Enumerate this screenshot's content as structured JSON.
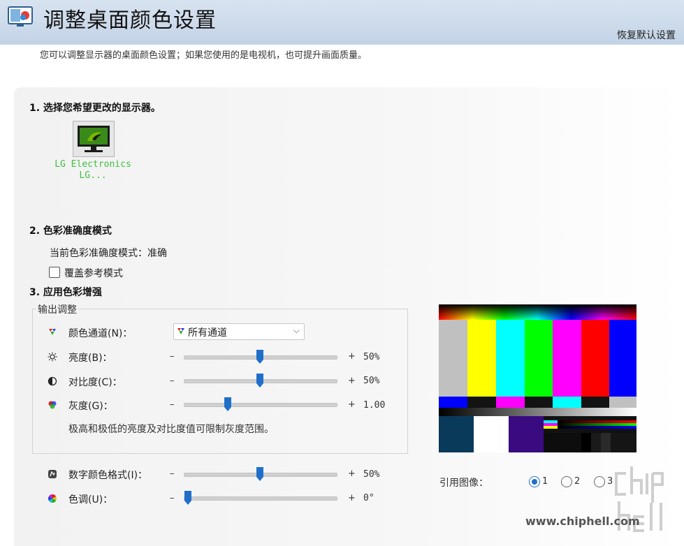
{
  "header": {
    "title": "调整桌面颜色设置",
    "restore_label": "恢复默认设置"
  },
  "description": "您可以调整显示器的桌面颜色设置；如果您使用的是电视机，也可提升画面质量。",
  "section1": {
    "title": "1. 选择您希望更改的显示器。",
    "monitor_name_line1": "LG Electronics",
    "monitor_name_line2": "LG..."
  },
  "section2": {
    "title": "2. 色彩准确度模式",
    "current_mode": "当前色彩准确度模式：准确",
    "override_label": "覆盖参考模式",
    "override_checked": false
  },
  "section3": {
    "title": "3. 应用色彩增强",
    "output_group_label": "输出调整",
    "channel": {
      "label": "颜色通道(N)：",
      "selected": "所有通道"
    },
    "sliders": [
      {
        "label": "亮度(B)：",
        "minus": "–",
        "plus": "+",
        "value": "50%",
        "level": 0.5,
        "icon": "sun-icon"
      },
      {
        "label": "对比度(C)：",
        "minus": "–",
        "plus": "+",
        "value": "50%",
        "level": 0.5,
        "icon": "contrast-icon"
      },
      {
        "label": "灰度(G)：",
        "minus": "–",
        "plus": "+",
        "value": "1.00",
        "level": 0.29,
        "icon": "color-wheel-icon"
      }
    ],
    "hint": "极高和极低的亮度及对比度值可限制灰度范围。",
    "digital_vibrance": {
      "label": "数字颜色格式(I)：",
      "minus": "–",
      "plus": "+",
      "value": "50%",
      "level": 0.5,
      "icon": "vibrance-icon"
    },
    "hue": {
      "label": "色调(U)：",
      "minus": "–",
      "plus": "+",
      "value": "0°",
      "level": 0.0,
      "icon": "hue-icon"
    }
  },
  "reference": {
    "label": "引用图像：",
    "options": [
      "1",
      "2",
      "3"
    ],
    "selected": "1"
  },
  "watermark": "www.chiphell.com",
  "colors": {
    "accent": "#1f6fc9",
    "header_bg": "#c8d7e8",
    "monitor_text": "#3fbf3f",
    "panel_bg": "#f3f3f3"
  }
}
